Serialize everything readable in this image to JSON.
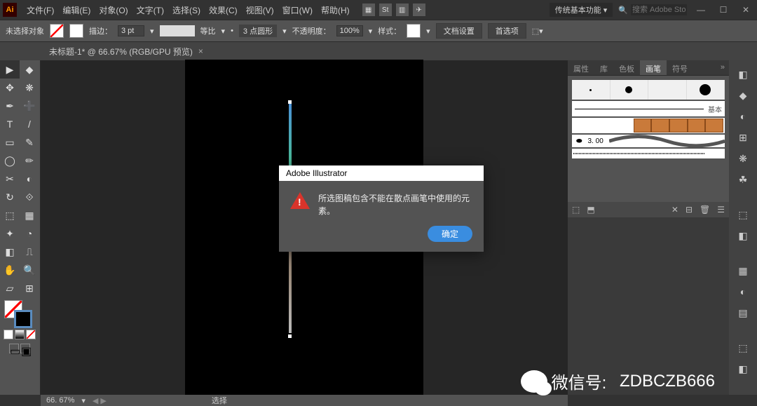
{
  "app": {
    "logo": "Ai"
  },
  "menu": {
    "file": "文件(F)",
    "edit": "编辑(E)",
    "object": "对象(O)",
    "type": "文字(T)",
    "select": "选择(S)",
    "effect": "效果(C)",
    "view": "视图(V)",
    "window": "窗口(W)",
    "help": "帮助(H)"
  },
  "workspace": {
    "name": "传统基本功能"
  },
  "stock_search": {
    "icon": "🔍",
    "placeholder": "搜索 Adobe Stock"
  },
  "window_controls": {
    "min": "—",
    "max": "☐",
    "close": "✕"
  },
  "control": {
    "selection_state": "未选择对象",
    "stroke_label": "描边：",
    "stroke_val": "3 pt",
    "profile_label": "等比",
    "brush_label": "3 点圆形",
    "opacity_label": "不透明度：",
    "opacity_val": "100%",
    "style_label": "样式：",
    "docsetup": "文档设置",
    "prefs": "首选项"
  },
  "doc_tab": {
    "title": "未标题-1* @ 66.67% (RGB/GPU 预览)",
    "close": "×"
  },
  "tools": [
    "▶",
    "◆",
    "✥",
    "❋",
    "✒",
    "➕",
    "T",
    "/",
    "▭",
    "✎",
    "◯",
    "✏",
    "✂",
    "◐",
    "↻",
    "⟐",
    "⬚",
    "▦",
    "✦",
    "◔",
    "◧",
    "⎍",
    "✋",
    "🔍",
    "▱",
    "⊞"
  ],
  "brush_panel": {
    "tabs": {
      "props": "属性",
      "lib": "库",
      "swatch": "色板",
      "brush": "画笔",
      "symbol": "符号",
      "more": "»"
    },
    "basic_label": "基本",
    "callig_val": "3. 00",
    "footer_icons": [
      "⬚",
      "⬒",
      "✕",
      "⊟",
      "🗑",
      "☰"
    ]
  },
  "dialog": {
    "title": "Adobe Illustrator",
    "message": "所选图稿包含不能在散点画笔中使用的元素。",
    "ok": "确定"
  },
  "status": {
    "zoom": "66. 67%",
    "nav": "◀ ▶",
    "select_label": "选择"
  },
  "watermark": {
    "label": "微信号:",
    "id": "ZDBCZB666"
  },
  "rail_icons": [
    "◧",
    "◆",
    "◐",
    "⊞",
    "❋",
    "☘",
    "⬚",
    "◧",
    "▦",
    "◐",
    "▤",
    "⬚",
    "◧"
  ]
}
